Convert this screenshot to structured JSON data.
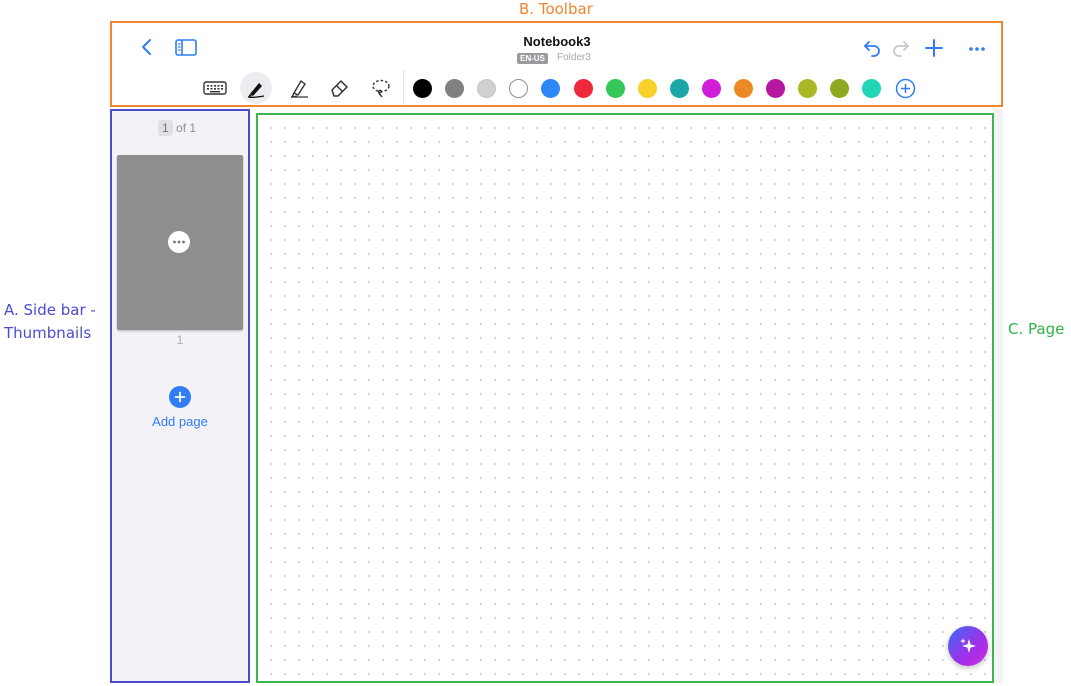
{
  "annotations": {
    "toolbar": "B. Toolbar",
    "sidebar_line1": "A. Side bar -",
    "sidebar_line2": "Thumbnails",
    "page": "C. Page"
  },
  "toolbar": {
    "title": "Notebook3",
    "language_badge": "EN-US",
    "folder": "Folder3",
    "icons": [
      "back-icon",
      "sidebar-toggle-icon",
      "undo-icon",
      "redo-icon",
      "add-icon",
      "more-icon"
    ],
    "tools": [
      "keyboard-icon",
      "pen-icon",
      "highlighter-icon",
      "eraser-icon",
      "lasso-icon"
    ],
    "selected_tool": "pen",
    "accent_color": "#2f7cf6",
    "colors": [
      "#000000",
      "#808080",
      "#d0d0d0",
      "#ffffff",
      "#2f86f6",
      "#f0283c",
      "#34c759",
      "#f7d02a",
      "#1aa7a5",
      "#d21ed8",
      "#eb8a25",
      "#b5189e",
      "#a9b926",
      "#8ea821",
      "#1fd6b5"
    ]
  },
  "sidebar": {
    "page_current": "1",
    "page_of": "of 1",
    "thumbnails": [
      {
        "label": "1"
      }
    ],
    "add_page_label": "Add page"
  }
}
